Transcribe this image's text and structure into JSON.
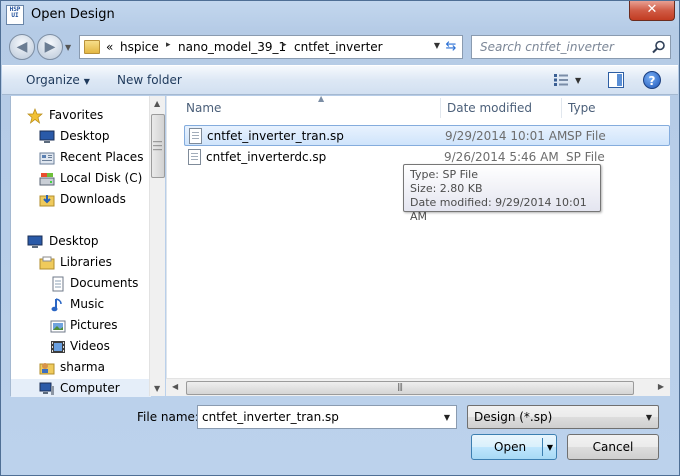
{
  "window": {
    "title": "Open Design",
    "app_icon_text": "HSP UI",
    "close_glyph": "✕"
  },
  "address_bar": {
    "prefix": "«",
    "crumbs": [
      "hspice",
      "nano_model_39_1",
      "cntfet_inverter"
    ],
    "separator": "▸"
  },
  "search": {
    "placeholder": "Search cntfet_inverter"
  },
  "toolbar": {
    "organize_label": "Organize",
    "new_folder_label": "New folder",
    "help_glyph": "?"
  },
  "nav": {
    "items": [
      {
        "label": "Favorites",
        "icon": "star-icon"
      },
      {
        "label": "Desktop",
        "icon": "desktop-icon"
      },
      {
        "label": "Recent Places",
        "icon": "recent-places-icon"
      },
      {
        "label": "Local Disk (C)",
        "icon": "disk-icon"
      },
      {
        "label": "Downloads",
        "icon": "downloads-icon"
      },
      {
        "label": "Desktop",
        "icon": "desktop-icon"
      },
      {
        "label": "Libraries",
        "icon": "libraries-icon"
      },
      {
        "label": "Documents",
        "icon": "documents-icon"
      },
      {
        "label": "Music",
        "icon": "music-icon"
      },
      {
        "label": "Pictures",
        "icon": "pictures-icon"
      },
      {
        "label": "Videos",
        "icon": "videos-icon"
      },
      {
        "label": "sharma",
        "icon": "user-folder-icon"
      },
      {
        "label": "Computer",
        "icon": "computer-icon"
      }
    ]
  },
  "file_list": {
    "columns": {
      "name": "Name",
      "date": "Date modified",
      "type": "Type"
    },
    "rows": [
      {
        "name": "cntfet_inverter_tran.sp",
        "date": "9/29/2014 10:01 AM",
        "type": "SP File"
      },
      {
        "name": "cntfet_inverterdc.sp",
        "date": "9/26/2014 5:46 AM",
        "type": "SP File"
      }
    ]
  },
  "tooltip": {
    "type_line": "Type: SP File",
    "size_line": "Size: 2.80 KB",
    "date_line": "Date modified: 9/29/2014 10:01 AM"
  },
  "footer": {
    "file_name_label": "File name:",
    "file_name_value": "cntfet_inverter_tran.sp",
    "filter_value": "Design (*.sp)",
    "open_label": "Open",
    "cancel_label": "Cancel"
  },
  "colors": {
    "selection_border": "#84acdd",
    "accent_blue": "#2a6fd4"
  }
}
